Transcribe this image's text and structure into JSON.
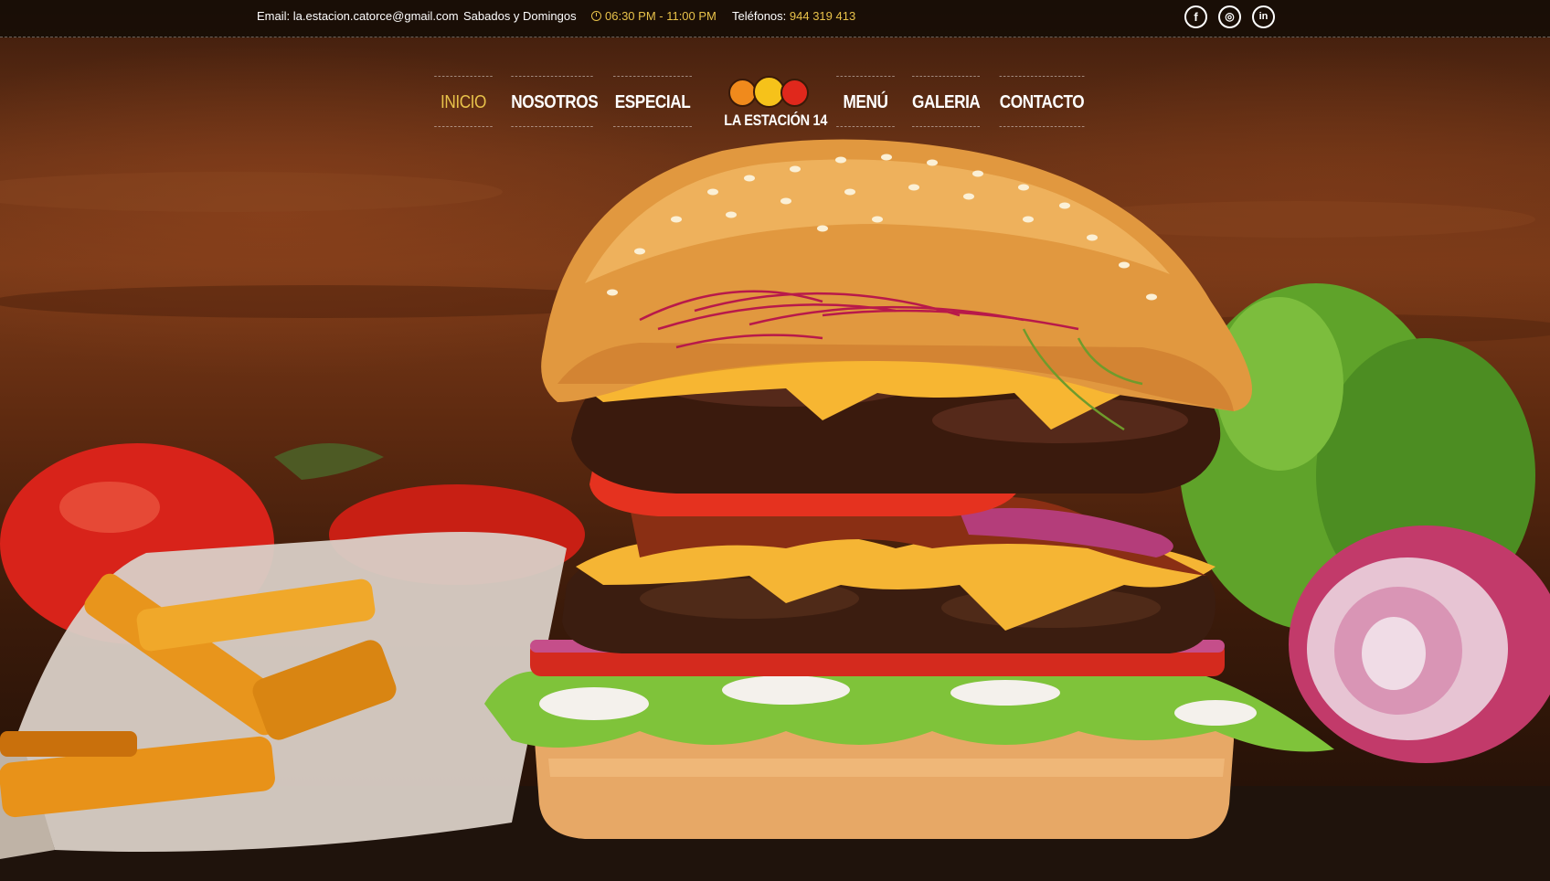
{
  "topbar": {
    "email_label": "Email:",
    "email_value": "la.estacion.catorce@gmail.com",
    "days": "Sabados y Domingos",
    "hours": "06:30 PM - 11:00 PM",
    "phone_label": "Teléfonos:",
    "phone_value": "944 319 413",
    "social": [
      {
        "name": "facebook-icon",
        "glyph": "f"
      },
      {
        "name": "instagram-icon",
        "glyph": "◎"
      },
      {
        "name": "linkedin-icon",
        "glyph": "in"
      }
    ]
  },
  "nav": {
    "left": [
      "INICIO",
      "NOSOTROS",
      "ESPECIAL"
    ],
    "right": [
      "MENÚ",
      "GALERIA",
      "CONTACTO"
    ],
    "active": "INICIO"
  },
  "logo": {
    "text": "LA ESTACIÓN 14"
  },
  "colors": {
    "accent": "#e8c24a",
    "topbar_bg": "#140c06"
  }
}
